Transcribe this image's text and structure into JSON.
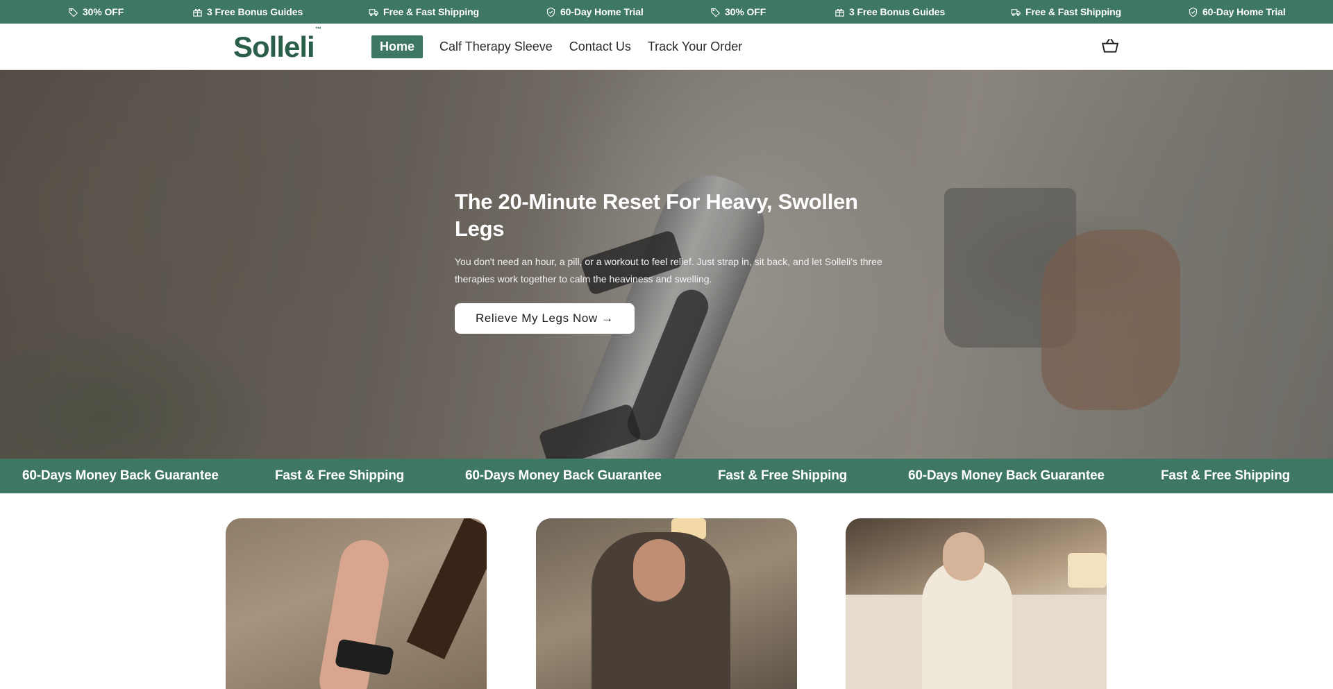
{
  "announcement": {
    "items": [
      {
        "icon": "tag-icon",
        "label": "30% OFF"
      },
      {
        "icon": "gift-icon",
        "label": "3 Free Bonus Guides"
      },
      {
        "icon": "truck-icon",
        "label": "Free & Fast Shipping"
      },
      {
        "icon": "shield-check-icon",
        "label": "60-Day Home Trial"
      },
      {
        "icon": "tag-icon",
        "label": "30% OFF"
      },
      {
        "icon": "gift-icon",
        "label": "3 Free Bonus Guides"
      },
      {
        "icon": "truck-icon",
        "label": "Free & Fast Shipping"
      },
      {
        "icon": "shield-check-icon",
        "label": "60-Day Home Trial"
      }
    ]
  },
  "header": {
    "logo": "Solleli",
    "logo_tm": "™",
    "nav": [
      "Home",
      "Calf Therapy Sleeve",
      "Contact Us",
      "Track Your Order"
    ],
    "active_nav": "Home",
    "cart_icon": "basket-icon"
  },
  "hero": {
    "title": "The 20-Minute Reset For Heavy, Swollen Legs",
    "subtitle": "You don't need an hour, a pill, or a workout to feel relief. Just strap in, sit back, and let Solleli's three therapies work together to calm the heaviness and swelling.",
    "cta": "Relieve My Legs Now →"
  },
  "strip": {
    "items": [
      "60-Days Money Back Guarantee",
      "Fast & Free Shipping",
      "60-Days Money Back Guarantee",
      "Fast & Free Shipping",
      "60-Days Money Back Guarantee",
      "Fast & Free Shipping"
    ]
  },
  "colors": {
    "brand_green": "#3e7762",
    "logo_green": "#2b5e49"
  }
}
